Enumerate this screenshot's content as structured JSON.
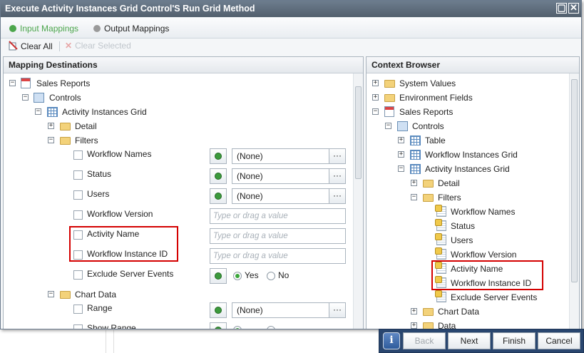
{
  "window": {
    "title": "Execute Activity Instances Grid Control'S Run Grid Method",
    "minimize_icon": "restore-icon",
    "close_icon": "close-icon"
  },
  "tabs": [
    {
      "label": "Input Mappings",
      "active": true,
      "color": "#4ca64c"
    },
    {
      "label": "Output Mappings",
      "active": false,
      "color": "#9a9a9a"
    }
  ],
  "toolbar": {
    "clear_all": "Clear All",
    "clear_selected": "Clear Selected"
  },
  "left_panel": {
    "title": "Mapping Destinations",
    "tree": [
      "Sales Reports",
      "Controls",
      "Activity Instances Grid",
      "Detail",
      "Filters"
    ],
    "fields": [
      {
        "label": "Workflow Names",
        "value": "(None)"
      },
      {
        "label": "Status",
        "value": "(None)"
      },
      {
        "label": "Users",
        "value": "(None)"
      },
      {
        "label": "Workflow Version",
        "placeholder": "Type or drag a value"
      },
      {
        "label": "Activity Name",
        "placeholder": "Type or drag a value"
      },
      {
        "label": "Workflow Instance ID",
        "placeholder": "Type or drag a value"
      },
      {
        "label": "Exclude Server Events",
        "yes": "Yes",
        "no": "No",
        "selected": "Yes"
      }
    ],
    "chart_data_node": "Chart Data",
    "chart_fields": [
      {
        "label": "Range",
        "value": "(None)"
      },
      {
        "label": "Show Range"
      }
    ],
    "ellipsis": "···"
  },
  "right_panel": {
    "title": "Context Browser",
    "tree": [
      "System Values",
      "Environment Fields",
      "Sales Reports",
      "Controls",
      "Table",
      "Workflow Instances Grid",
      "Activity Instances Grid",
      "Detail",
      "Filters",
      "Workflow Names",
      "Status",
      "Users",
      "Workflow Version",
      "Activity Name",
      "Workflow Instance ID",
      "Exclude Server Events",
      "Chart Data",
      "Data"
    ]
  },
  "footer": {
    "info_icon": "info-icon",
    "back": "Back",
    "next": "Next",
    "finish": "Finish",
    "cancel": "Cancel"
  },
  "colors": {
    "titlebar": "#5e6b7a",
    "highlight": "#d40000",
    "footer": "#29466f"
  }
}
